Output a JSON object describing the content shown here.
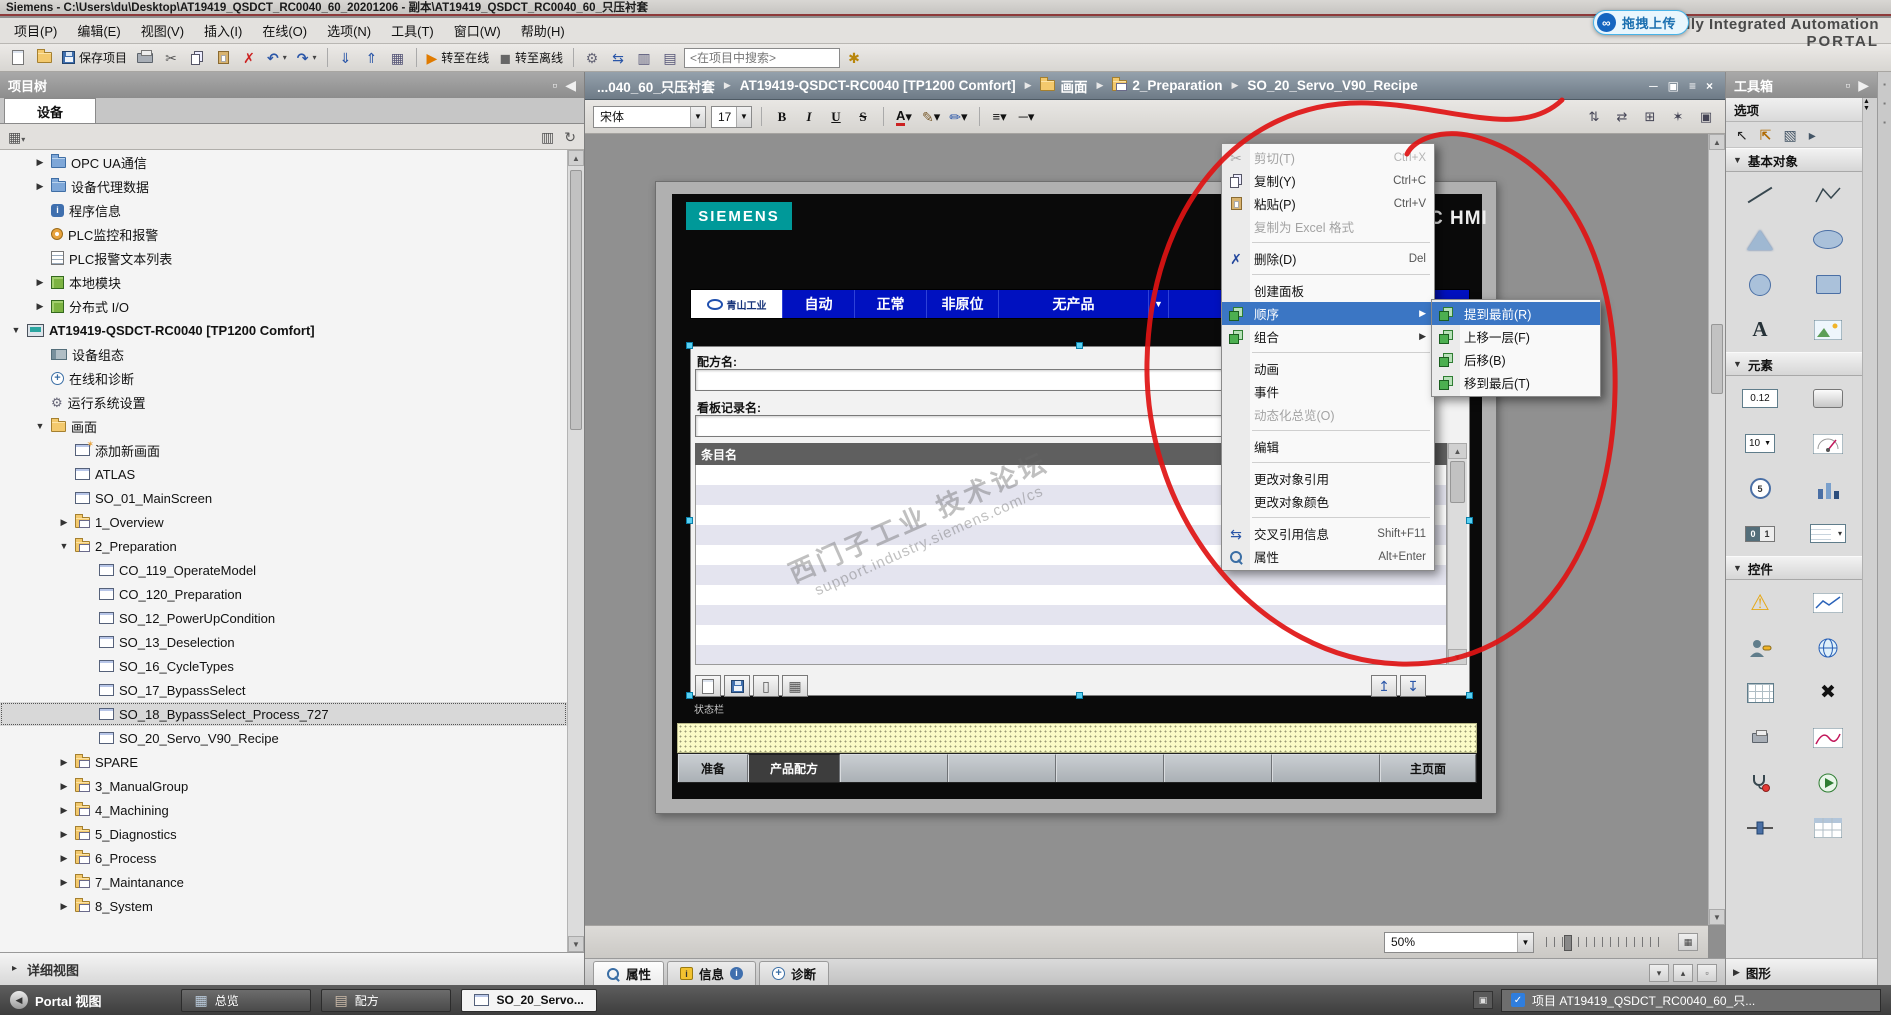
{
  "title_bar": {
    "text": "Siemens  -  C:\\Users\\du\\Desktop\\AT19419_QSDCT_RC0040_60_20201206 - 副本\\AT19419_QSDCT_RC0040_60_只压衬套"
  },
  "menu_bar": {
    "items": [
      "项目(P)",
      "编辑(E)",
      "视图(V)",
      "插入(I)",
      "在线(O)",
      "选项(N)",
      "工具(T)",
      "窗口(W)",
      "帮助(H)"
    ]
  },
  "branding": {
    "line1": "Totally Integrated Automation",
    "line2": "PORTAL",
    "badge": "拖拽上传",
    "badge_icon": "∞"
  },
  "toolbar": {
    "search_value": "<在项目中搜索>",
    "buttons": [
      {
        "name": "new-project-button",
        "icon": "doc"
      },
      {
        "name": "open-project-button",
        "icon": "folder"
      },
      {
        "name": "save-project-button",
        "icon": "floppy",
        "label": "保存项目"
      },
      {
        "name": "print-button",
        "icon": "print"
      },
      {
        "name": "cut-button",
        "icon": "cut"
      },
      {
        "name": "copy-button",
        "icon": "copy"
      },
      {
        "name": "paste-button",
        "icon": "paste"
      },
      {
        "name": "delete-button",
        "icon": "delx"
      },
      {
        "name": "undo-button",
        "icon": "undo",
        "dd": true
      },
      {
        "name": "redo-button",
        "icon": "redo",
        "dd": true
      },
      {
        "sep": true
      },
      {
        "name": "download-button",
        "icon": "dl"
      },
      {
        "name": "upload-button",
        "icon": "ul"
      },
      {
        "name": "simulation-button",
        "icon": "sim"
      },
      {
        "sep": true
      },
      {
        "name": "go-online-button",
        "icon": "online",
        "label": "转至在线"
      },
      {
        "name": "go-offline-button",
        "icon": "offline",
        "label": "转至离线"
      },
      {
        "sep": true
      },
      {
        "name": "diagnostics-button",
        "icon": "gear"
      },
      {
        "name": "cross-reference-button",
        "icon": "xswap"
      },
      {
        "name": "split-horizontal-button",
        "icon": "winh"
      },
      {
        "name": "split-vertical-button",
        "icon": "winv"
      },
      {
        "search": true
      },
      {
        "name": "library-button",
        "icon": "lib"
      }
    ]
  },
  "project_tree": {
    "title": "项目树",
    "tab": "设备",
    "detail_view": "详细视图",
    "items": [
      {
        "label": "OPC UA通信",
        "lvl": 2,
        "arrow": "r",
        "icon": "sysfolder"
      },
      {
        "label": "设备代理数据",
        "lvl": 2,
        "arrow": "r",
        "icon": "sysfolder"
      },
      {
        "label": "程序信息",
        "lvl": 2,
        "icon": "info"
      },
      {
        "label": "PLC监控和报警",
        "lvl": 2,
        "icon": "alarm"
      },
      {
        "label": "PLC报警文本列表",
        "lvl": 2,
        "icon": "textlist"
      },
      {
        "label": "本地模块",
        "lvl": 2,
        "arrow": "r",
        "icon": "module"
      },
      {
        "label": "分布式 I/O",
        "lvl": 2,
        "arrow": "r",
        "icon": "module"
      },
      {
        "label": "AT19419-QSDCT-RC0040 [TP1200 Comfort]",
        "lvl": 1,
        "arrow": "d",
        "icon": "hmi",
        "device": true
      },
      {
        "label": "设备组态",
        "lvl": 2,
        "icon": "devcfg"
      },
      {
        "label": "在线和诊断",
        "lvl": 2,
        "icon": "onlinediag"
      },
      {
        "label": "运行系统设置",
        "lvl": 2,
        "icon": "runtime"
      },
      {
        "label": "画面",
        "lvl": 2,
        "arrow": "d",
        "icon": "folder"
      },
      {
        "label": "添加新画面",
        "lvl": 3,
        "icon": "addscreen"
      },
      {
        "label": "ATLAS",
        "lvl": 3,
        "icon": "screen"
      },
      {
        "label": "SO_01_MainScreen",
        "lvl": 3,
        "icon": "screen"
      },
      {
        "label": "1_Overview",
        "lvl": 3,
        "arrow": "r",
        "icon": "groupfolder"
      },
      {
        "label": "2_Preparation",
        "lvl": 3,
        "arrow": "d",
        "icon": "groupfolder"
      },
      {
        "label": "CO_119_OperateModel",
        "lvl": 4,
        "icon": "screen"
      },
      {
        "label": "CO_120_Preparation",
        "lvl": 4,
        "icon": "screen"
      },
      {
        "label": "SO_12_PowerUpCondition",
        "lvl": 4,
        "icon": "screen"
      },
      {
        "label": "SO_13_Deselection",
        "lvl": 4,
        "icon": "screen"
      },
      {
        "label": "SO_16_CycleTypes",
        "lvl": 4,
        "icon": "screen"
      },
      {
        "label": "SO_17_BypassSelect",
        "lvl": 4,
        "icon": "screen"
      },
      {
        "label": "SO_18_BypassSelect_Process_727",
        "lvl": 4,
        "icon": "screen",
        "selected": true
      },
      {
        "label": "SO_20_Servo_V90_Recipe",
        "lvl": 4,
        "icon": "screen"
      },
      {
        "label": "SPARE",
        "lvl": 3,
        "arrow": "r",
        "icon": "groupfolder"
      },
      {
        "label": "3_ManualGroup",
        "lvl": 3,
        "arrow": "r",
        "icon": "groupfolder"
      },
      {
        "label": "4_Machining",
        "lvl": 3,
        "arrow": "r",
        "icon": "groupfolder"
      },
      {
        "label": "5_Diagnostics",
        "lvl": 3,
        "arrow": "r",
        "icon": "groupfolder"
      },
      {
        "label": "6_Process",
        "lvl": 3,
        "arrow": "r",
        "icon": "groupfolder"
      },
      {
        "label": "7_Maintanance",
        "lvl": 3,
        "arrow": "r",
        "icon": "groupfolder"
      },
      {
        "label": "8_System",
        "lvl": 3,
        "arrow": "r",
        "icon": "groupfolder"
      }
    ]
  },
  "editor": {
    "breadcrumb": {
      "crumbs": [
        {
          "label": "...040_60_只压衬套"
        },
        {
          "label": "AT19419-QSDCT-RC0040 [TP1200 Comfort]"
        },
        {
          "label": "画面",
          "icon": "folder"
        },
        {
          "label": "2_Preparation",
          "icon": "groupfolder"
        },
        {
          "label": "SO_20_Servo_V90_Recipe"
        }
      ],
      "controls": [
        "─",
        "▣",
        "≡",
        "×"
      ]
    },
    "format_toolbar": {
      "font_name": "宋体",
      "font_size": "17",
      "style_buttons": [
        "B",
        "I",
        "U",
        "S"
      ],
      "right_glyphs": [
        "⇅",
        "⇄",
        "⊞",
        "✶",
        "▣"
      ]
    },
    "zoom": {
      "value": "50%"
    },
    "hmi": {
      "brand": "SIEMENS",
      "model_text": "SIMATIC HMI",
      "station_logo_text": "青山工业",
      "nav_items": [
        "自动",
        "正常",
        "非原位",
        "无产品"
      ],
      "recipe_name_label": "配方名:",
      "board_record_label": "看板记录名:",
      "entry_header": "条目名",
      "status_label": "状态栏",
      "screen_tabs": [
        "准备",
        "产品配方",
        "",
        "",
        "",
        "",
        "",
        "主页面"
      ],
      "active_tab_index": 1,
      "watermark_line1": "西门子工业 技术论坛",
      "watermark_line2": "support.industry.siemens.com/cs"
    }
  },
  "context_menu": {
    "items": [
      {
        "label": "剪切(T)",
        "shortcut": "Ctrl+X",
        "icon": "cut",
        "disabled": true
      },
      {
        "label": "复制(Y)",
        "shortcut": "Ctrl+C",
        "icon": "copy"
      },
      {
        "label": "粘贴(P)",
        "shortcut": "Ctrl+V",
        "icon": "paste"
      },
      {
        "label": "复制为 Excel 格式",
        "disabled": true
      },
      {
        "sep": true
      },
      {
        "label": "删除(D)",
        "shortcut": "Del",
        "icon": "delblue"
      },
      {
        "sep": true
      },
      {
        "label": "创建面板"
      },
      {
        "label": "顺序",
        "arrow": true,
        "icon": "lyr",
        "highlighted": true
      },
      {
        "label": "组合",
        "arrow": true,
        "icon": "lyr"
      },
      {
        "sep": true
      },
      {
        "label": "动画"
      },
      {
        "label": "事件"
      },
      {
        "label": "动态化总览(O)",
        "disabled": true
      },
      {
        "sep": true
      },
      {
        "label": "编辑"
      },
      {
        "sep": true
      },
      {
        "label": "更改对象引用"
      },
      {
        "label": "更改对象颜色"
      },
      {
        "sep": true
      },
      {
        "label": "交叉引用信息",
        "shortcut": "Shift+F11",
        "icon": "xswap"
      },
      {
        "label": "属性",
        "shortcut": "Alt+Enter",
        "icon": "mag"
      }
    ],
    "submenu": [
      {
        "label": "提到最前(R)",
        "icon": "lyr",
        "highlighted": true
      },
      {
        "label": "上移一层(F)",
        "icon": "lyr"
      },
      {
        "label": "后移(B)",
        "icon": "lyr"
      },
      {
        "label": "移到最后(T)",
        "icon": "lyr"
      }
    ]
  },
  "toolbox": {
    "title": "工具箱",
    "options_label": "选项",
    "pointer_icons": [
      "arrow",
      "hand",
      "marquee"
    ],
    "sections": [
      {
        "label": "基本对象",
        "cells": [
          {
            "name": "line-tool",
            "k": "line"
          },
          {
            "name": "polyline-tool",
            "k": "poly"
          },
          {
            "name": "polygon-tool",
            "k": "tri"
          },
          {
            "name": "ellipse-tool",
            "k": "ell"
          },
          {
            "name": "circle-tool",
            "k": "cir"
          },
          {
            "name": "rectangle-tool",
            "k": "rect"
          },
          {
            "name": "text-field-tool",
            "k": "text",
            "glyph": "A"
          },
          {
            "name": "graphic-view-tool",
            "k": "img"
          }
        ]
      },
      {
        "label": "元素",
        "cells": [
          {
            "name": "io-field-tool",
            "k": "io",
            "glyph": "0.12"
          },
          {
            "name": "button-tool",
            "k": "btn2"
          },
          {
            "name": "spin-field-tool",
            "k": "spin",
            "glyph": "10"
          },
          {
            "name": "graphic-io-field-tool",
            "k": "gio"
          },
          {
            "name": "date-time-field-tool",
            "k": "clock",
            "glyph": "5"
          },
          {
            "name": "bar-tool",
            "k": "bars"
          },
          {
            "name": "switch-tool",
            "k": "sw"
          },
          {
            "name": "symbolic-io-field-tool",
            "k": "symio",
            "glyph": "▾"
          }
        ]
      },
      {
        "label": "控件",
        "cells": [
          {
            "name": "alarm-view-tool",
            "k": "warn"
          },
          {
            "name": "trend-view-tool",
            "k": "trend"
          },
          {
            "name": "user-view-tool",
            "k": "user"
          },
          {
            "name": "html-browser-tool",
            "k": "globe"
          },
          {
            "name": "recipe-view-tool",
            "k": "grid2"
          },
          {
            "name": "status-force-tool",
            "k": "xblack",
            "glyph": "✖"
          },
          {
            "name": "print-job-tool",
            "k": "printer"
          },
          {
            "name": "fx-trend-tool",
            "k": "curve"
          },
          {
            "name": "system-diagnostics-tool",
            "k": "diagv"
          },
          {
            "name": "media-player-tool",
            "k": "media"
          },
          {
            "name": "slider-tool",
            "k": "slider"
          },
          {
            "name": "table-view-tool",
            "k": "tablev"
          }
        ]
      }
    ],
    "bottom_section": "图形"
  },
  "props_bar": {
    "tabs": [
      {
        "label": "属性",
        "icon": "mag",
        "active": true
      },
      {
        "label": "信息",
        "icon": "ibadge",
        "badge": "i"
      },
      {
        "label": "诊断",
        "icon": "onlinediag"
      }
    ]
  },
  "taskbar": {
    "portal_label": "Portal 视图",
    "buttons": [
      {
        "label": "总览",
        "icon": "ovr"
      },
      {
        "label": "配方",
        "icon": "rcp"
      },
      {
        "label": "SO_20_Servo...",
        "icon": "scr",
        "active": true
      }
    ],
    "status_text": "项目 AT19419_QSDCT_RC0040_60_只...",
    "status_check": "✓"
  }
}
